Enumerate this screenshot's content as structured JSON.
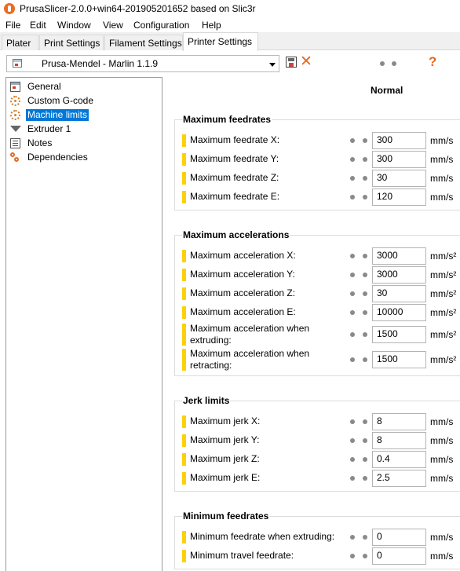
{
  "window": {
    "title": "PrusaSlicer-2.0.0+win64-201905201652 based on Slic3r"
  },
  "menu": [
    "File",
    "Edit",
    "Window",
    "View",
    "Configuration",
    "Help"
  ],
  "tabs": [
    {
      "label": "Plater",
      "active": false
    },
    {
      "label": "Print Settings",
      "active": false
    },
    {
      "label": "Filament Settings",
      "active": false
    },
    {
      "label": "Printer Settings",
      "active": true
    }
  ],
  "preset": {
    "selected": "Prusa-Mendel - Marlin 1.1.9"
  },
  "column_header": "Normal",
  "tree": [
    {
      "label": "General",
      "icon": "window-icon",
      "selected": false
    },
    {
      "label": "Custom G-code",
      "icon": "gear-icon",
      "selected": false
    },
    {
      "label": "Machine limits",
      "icon": "gear-icon",
      "selected": true
    },
    {
      "label": "Extruder 1",
      "icon": "funnel-icon",
      "selected": false
    },
    {
      "label": "Notes",
      "icon": "notes-icon",
      "selected": false
    },
    {
      "label": "Dependencies",
      "icon": "dependencies-icon",
      "selected": false
    }
  ],
  "groups": [
    {
      "title": "Maximum feedrates",
      "rows": [
        {
          "label": "Maximum feedrate X:",
          "value": "300",
          "unit": "mm/s"
        },
        {
          "label": "Maximum feedrate Y:",
          "value": "300",
          "unit": "mm/s"
        },
        {
          "label": "Maximum feedrate Z:",
          "value": "30",
          "unit": "mm/s"
        },
        {
          "label": "Maximum feedrate E:",
          "value": "120",
          "unit": "mm/s"
        }
      ]
    },
    {
      "title": "Maximum accelerations",
      "rows": [
        {
          "label": "Maximum acceleration X:",
          "value": "3000",
          "unit": "mm/s²"
        },
        {
          "label": "Maximum acceleration Y:",
          "value": "3000",
          "unit": "mm/s²"
        },
        {
          "label": "Maximum acceleration Z:",
          "value": "30",
          "unit": "mm/s²"
        },
        {
          "label": "Maximum acceleration E:",
          "value": "10000",
          "unit": "mm/s²"
        },
        {
          "label": "Maximum acceleration when extruding:",
          "value": "1500",
          "unit": "mm/s²"
        },
        {
          "label": "Maximum acceleration when retracting:",
          "value": "1500",
          "unit": "mm/s²"
        }
      ]
    },
    {
      "title": "Jerk limits",
      "rows": [
        {
          "label": "Maximum jerk X:",
          "value": "8",
          "unit": "mm/s"
        },
        {
          "label": "Maximum jerk Y:",
          "value": "8",
          "unit": "mm/s"
        },
        {
          "label": "Maximum jerk Z:",
          "value": "0.4",
          "unit": "mm/s"
        },
        {
          "label": "Maximum jerk E:",
          "value": "2.5",
          "unit": "mm/s"
        }
      ]
    },
    {
      "title": "Minimum feedrates",
      "rows": [
        {
          "label": "Minimum feedrate when extruding:",
          "value": "0",
          "unit": "mm/s"
        },
        {
          "label": "Minimum travel feedrate:",
          "value": "0",
          "unit": "mm/s"
        }
      ]
    }
  ]
}
